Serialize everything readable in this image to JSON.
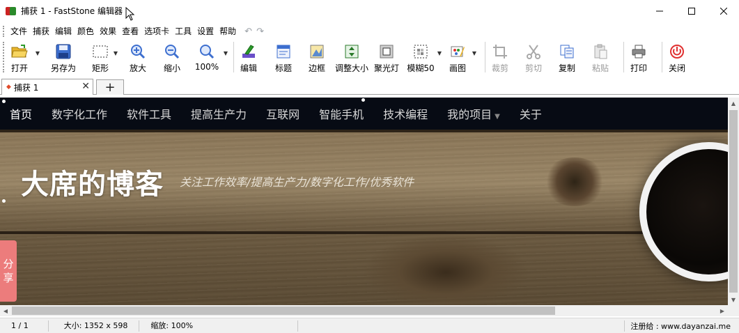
{
  "window": {
    "title": "捕获 1 - FastStone 编辑器",
    "minimize": "—",
    "maximize": "☐",
    "close": "✕"
  },
  "menu": [
    "文件",
    "捕获",
    "编辑",
    "颜色",
    "效果",
    "查看",
    "选项卡",
    "工具",
    "设置",
    "帮助"
  ],
  "toolbar": {
    "open": "打开",
    "save_as": "另存为",
    "rect": "矩形",
    "zoom_in": "放大",
    "zoom_out": "缩小",
    "zoom_level": "100%",
    "edit": "编辑",
    "caption": "标题",
    "border": "边框",
    "resize": "调整大小",
    "spotlight": "聚光灯",
    "blur": "模糊50",
    "draw": "画图",
    "crop": "裁剪",
    "cut": "剪切",
    "copy": "复制",
    "paste": "粘贴",
    "print": "打印",
    "close": "关闭"
  },
  "tabs": {
    "doc_tab": "捕获 1",
    "new_tab": "+"
  },
  "webpage": {
    "nav": [
      "首页",
      "数字化工作",
      "软件工具",
      "提高生产力",
      "互联网",
      "智能手机",
      "技术编程",
      "我的项目",
      "关于"
    ],
    "title": "大席的博客",
    "subtitle": "关注工作效率/提高生产力/数字化工作/优秀软件",
    "share": [
      "分",
      "享"
    ]
  },
  "status": {
    "page": "1 / 1",
    "size": "大小: 1352 x 598",
    "zoom": "缩放: 100%",
    "registered": "注册给 : www.dayanzai.me"
  },
  "colors": {
    "nav_bg": "#070b14",
    "share_bg": "#ec7c7c",
    "power_red": "#e03030"
  }
}
